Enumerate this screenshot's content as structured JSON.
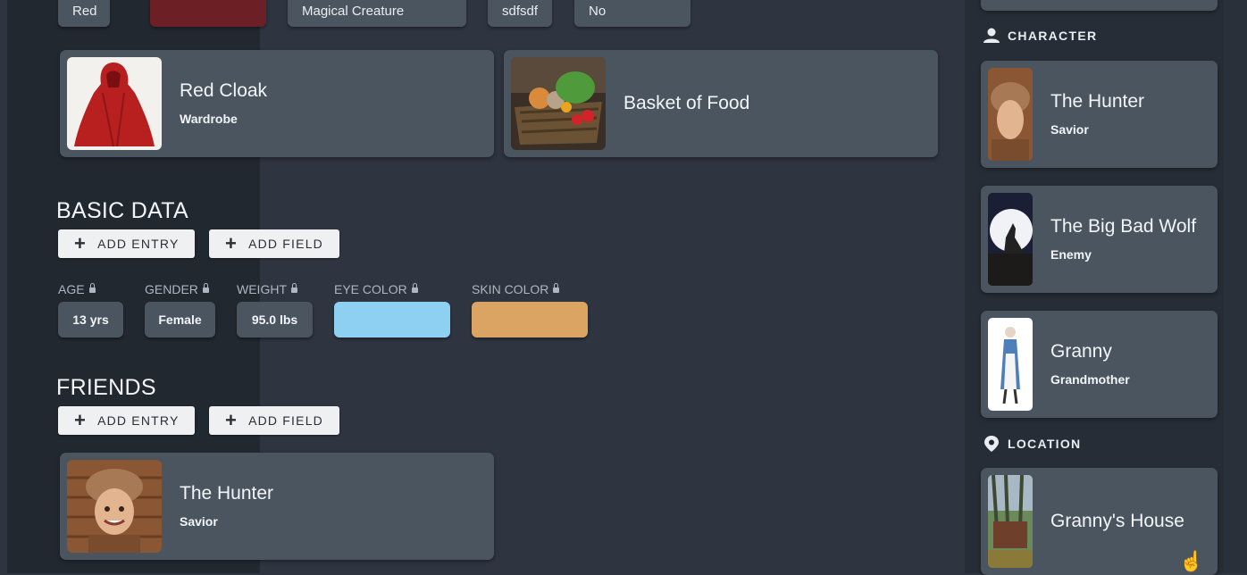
{
  "top_chips": {
    "chip1": "Red",
    "chip3": "Magical Creature",
    "chip4": "sdfsdf",
    "chip5": "No",
    "swatch_color": "#6c1f24"
  },
  "items": [
    {
      "title": "Red Cloak",
      "subtitle": "Wardrobe"
    },
    {
      "title": "Basket of Food",
      "subtitle": ""
    }
  ],
  "basic_data": {
    "title": "BASIC DATA",
    "add_entry": "ADD ENTRY",
    "add_field": "ADD FIELD",
    "fields": [
      {
        "label": "AGE",
        "value": "13 yrs"
      },
      {
        "label": "GENDER",
        "value": "Female"
      },
      {
        "label": "WEIGHT",
        "value": "95.0 lbs"
      },
      {
        "label": "EYE COLOR",
        "value": "",
        "color": "#8dd0f2"
      },
      {
        "label": "SKIN COLOR",
        "value": "",
        "color": "#dca462"
      }
    ]
  },
  "friends": {
    "title": "FRIENDS",
    "add_entry": "ADD ENTRY",
    "add_field": "ADD FIELD",
    "cards": [
      {
        "title": "The Hunter",
        "subtitle": "Savior"
      }
    ]
  },
  "sidebar": {
    "character_heading": "CHARACTER",
    "characters": [
      {
        "title": "The Hunter",
        "subtitle": "Savior"
      },
      {
        "title": "The Big Bad Wolf",
        "subtitle": "Enemy"
      },
      {
        "title": "Granny",
        "subtitle": "Grandmother"
      }
    ],
    "location_heading": "LOCATION",
    "locations": [
      {
        "title": "Granny's House",
        "subtitle": ""
      }
    ]
  }
}
